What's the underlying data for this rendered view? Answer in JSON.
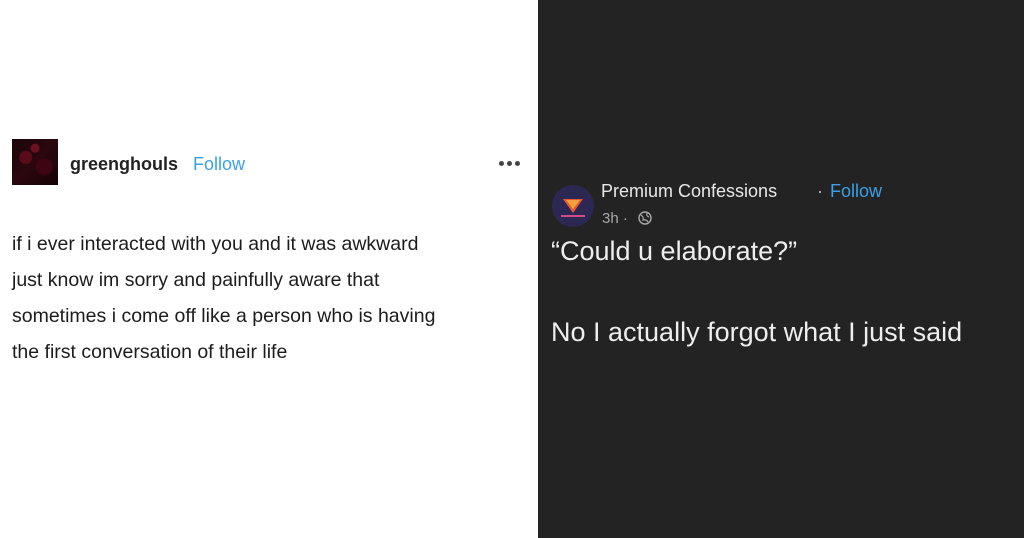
{
  "tumblr_post": {
    "username": "greenghouls",
    "follow_label": "Follow",
    "body_lines": [
      "if i ever interacted with you and it was awkward",
      "just know im sorry and painfully aware that",
      "sometimes i come off like a person who is having",
      "the first conversation of their life"
    ],
    "more_icon": "more-dots-icon"
  },
  "facebook_post": {
    "page_name": "Premium Confessions",
    "separator": "·",
    "follow_label": "Follow",
    "time": "3h ·",
    "privacy_icon": "globe-icon",
    "line1": "“Could u elaborate?”",
    "line2": "No I actually forgot what I just said"
  },
  "colors": {
    "left_background": "#ffffff",
    "right_background": "#232323",
    "follow_blue": "#3aa0e8"
  }
}
